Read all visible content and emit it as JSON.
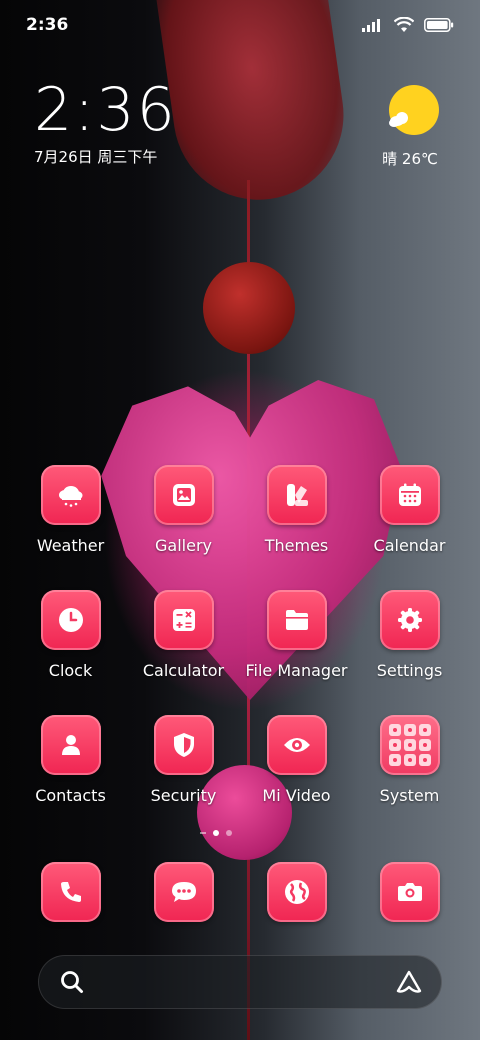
{
  "status_bar": {
    "time": "2:36",
    "icons": [
      "signal-icon",
      "wifi-icon",
      "battery-icon"
    ]
  },
  "clock_widget": {
    "time": "2:36",
    "date": "7月26日 周三下午"
  },
  "weather_widget": {
    "condition": "晴",
    "temperature": "26℃",
    "icon": "sun-cloud-icon"
  },
  "apps": [
    {
      "label": "Weather",
      "icon": "cloud-rain-icon"
    },
    {
      "label": "Gallery",
      "icon": "image-icon"
    },
    {
      "label": "Themes",
      "icon": "themes-icon"
    },
    {
      "label": "Calendar",
      "icon": "calendar-icon"
    },
    {
      "label": "Clock",
      "icon": "clock-icon"
    },
    {
      "label": "Calculator",
      "icon": "calculator-icon"
    },
    {
      "label": "File Manager",
      "icon": "folder-icon"
    },
    {
      "label": "Settings",
      "icon": "gear-icon"
    },
    {
      "label": "Contacts",
      "icon": "person-icon"
    },
    {
      "label": "Security",
      "icon": "shield-icon"
    },
    {
      "label": "Mi Video",
      "icon": "eye-icon"
    },
    {
      "label": "System",
      "icon": "folder-grid-icon"
    }
  ],
  "page_indicator": {
    "count": 2,
    "active": 1
  },
  "dock": [
    {
      "name": "Phone",
      "icon": "phone-icon"
    },
    {
      "name": "Messaging",
      "icon": "chat-icon"
    },
    {
      "name": "Browser",
      "icon": "globe-icon"
    },
    {
      "name": "Camera",
      "icon": "camera-icon"
    }
  ],
  "search": {
    "icon": "search-icon",
    "assistant_icon": "assistant-icon"
  },
  "colors": {
    "icon_accent": "#f02552",
    "icon_light": "#ff5a79"
  }
}
